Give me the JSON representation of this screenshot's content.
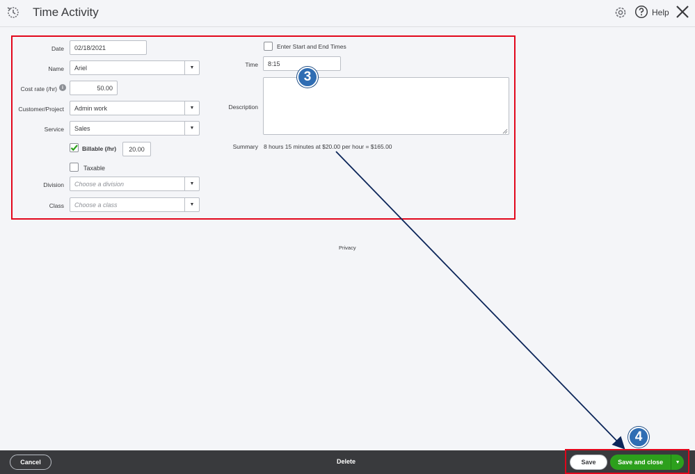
{
  "header": {
    "title": "Time Activity",
    "help_label": "Help"
  },
  "form": {
    "date": {
      "label": "Date",
      "value": "02/18/2021"
    },
    "name": {
      "label": "Name",
      "value": "Ariel"
    },
    "cost_rate": {
      "label": "Cost rate (/hr)",
      "value": "50.00"
    },
    "customer_project": {
      "label": "Customer/Project",
      "value": "Admin work"
    },
    "service": {
      "label": "Service",
      "value": "Sales"
    },
    "billable": {
      "label": "Billable (/hr)",
      "checked": true,
      "value": "20.00"
    },
    "taxable": {
      "label": "Taxable",
      "checked": false
    },
    "division": {
      "label": "Division",
      "placeholder": "Choose a division"
    },
    "class": {
      "label": "Class",
      "placeholder": "Choose a class"
    },
    "start_end": {
      "label": "Enter Start and End Times",
      "checked": false
    },
    "time": {
      "label": "Time",
      "value": "8:15"
    },
    "description": {
      "label": "Description",
      "value": ""
    },
    "summary": {
      "label": "Summary",
      "value": "8 hours 15 minutes at $20.00 per hour = $165.00"
    }
  },
  "privacy": "Privacy",
  "annotations": {
    "badge_3": "3",
    "badge_4": "4"
  },
  "footer": {
    "cancel_label": "Cancel",
    "delete_label": "Delete",
    "save_label": "Save",
    "save_close_label": "Save and close"
  },
  "colors": {
    "primary_green": "#2ca01c",
    "highlight_red": "#e2061b",
    "badge_blue": "#2f6db3",
    "footer_bg": "#393a3d"
  }
}
